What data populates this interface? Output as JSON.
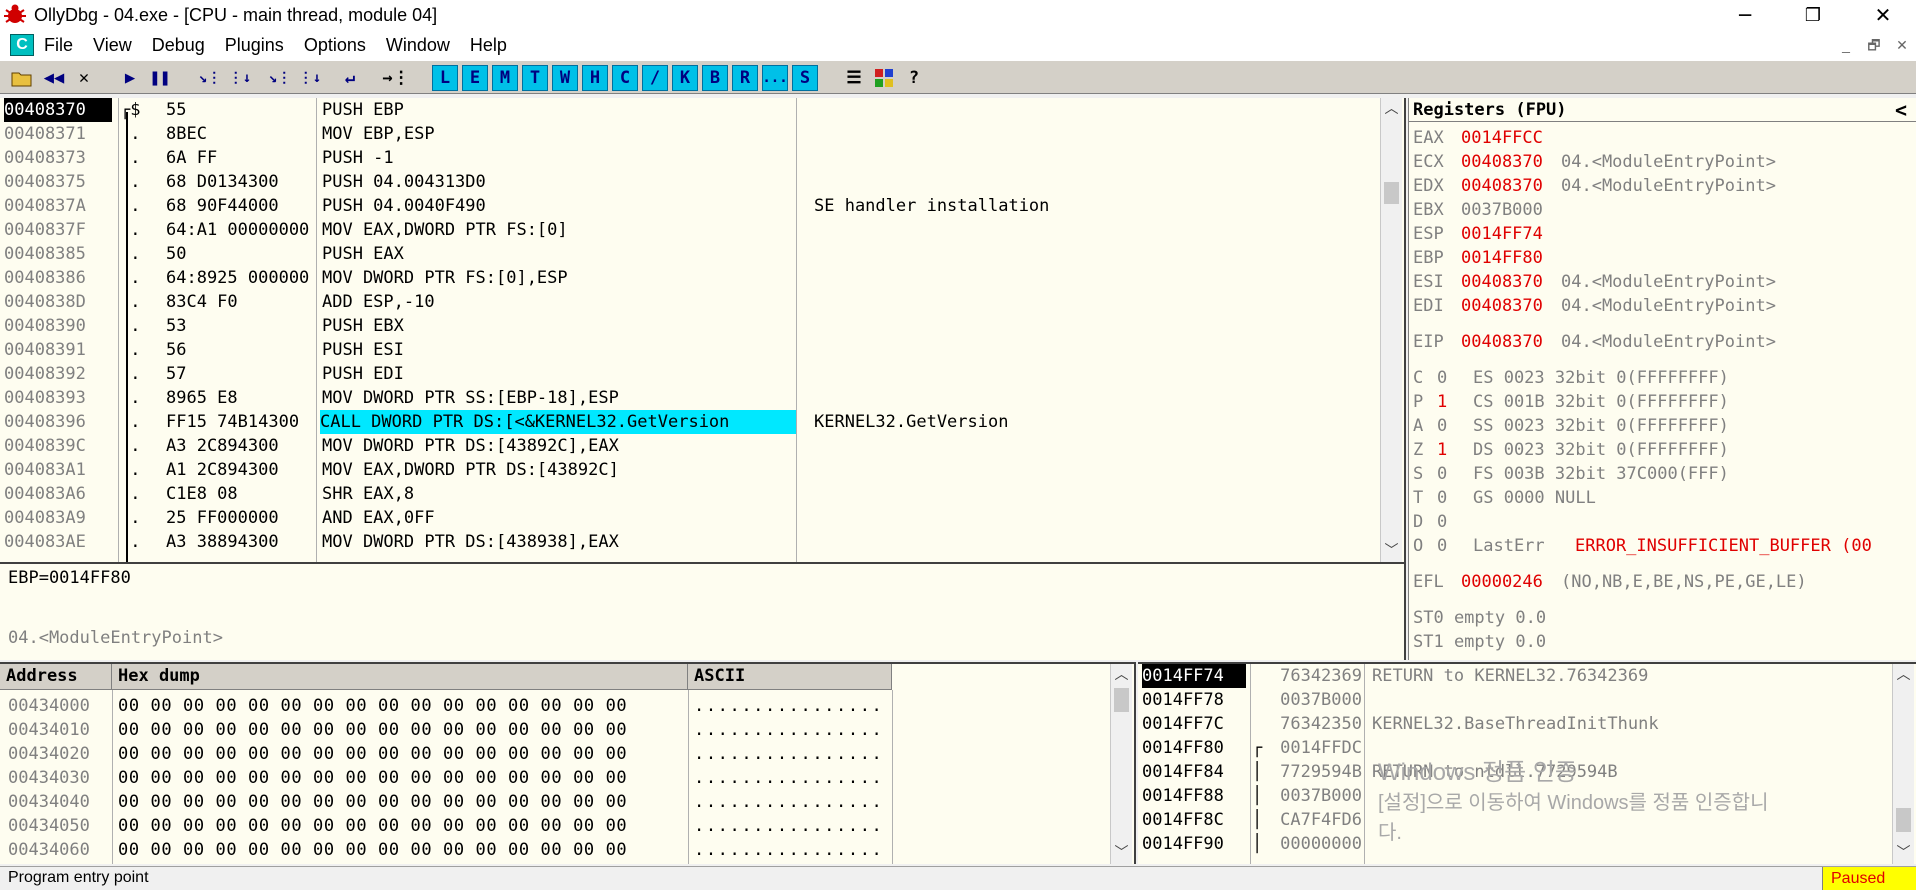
{
  "window": {
    "title": "OllyDbg - 04.exe - [CPU - main thread, module 04]",
    "minimize": "─",
    "restore": "❐",
    "close": "✕"
  },
  "menu": {
    "c_label": "C",
    "items": [
      "File",
      "View",
      "Debug",
      "Plugins",
      "Options",
      "Window",
      "Help"
    ],
    "mdi": [
      "_",
      "🗗",
      "✕"
    ]
  },
  "toolbar": {
    "letters": [
      "L",
      "E",
      "M",
      "T",
      "W",
      "H",
      "C",
      "/",
      "K",
      "B",
      "R",
      "...",
      "S"
    ],
    "help": "?"
  },
  "disasm": {
    "rows": [
      {
        "addr": "00408370",
        "mark": "┌$",
        "hex": "55",
        "cmd": "PUSH EBP",
        "comment": "",
        "selected": true
      },
      {
        "addr": "00408371",
        "mark": " .",
        "hex": "8BEC",
        "cmd": "MOV EBP,ESP",
        "comment": ""
      },
      {
        "addr": "00408373",
        "mark": " .",
        "hex": "6A FF",
        "cmd": "PUSH -1",
        "comment": ""
      },
      {
        "addr": "00408375",
        "mark": " .",
        "hex": "68 D0134300",
        "cmd": "PUSH 04.004313D0",
        "comment": ""
      },
      {
        "addr": "0040837A",
        "mark": " .",
        "hex": "68 90F44000",
        "cmd": "PUSH 04.0040F490",
        "comment": "SE handler installation"
      },
      {
        "addr": "0040837F",
        "mark": " .",
        "hex": "64:A1 00000000",
        "cmd": "MOV EAX,DWORD PTR FS:[0]",
        "comment": ""
      },
      {
        "addr": "00408385",
        "mark": " .",
        "hex": "50",
        "cmd": "PUSH EAX",
        "comment": ""
      },
      {
        "addr": "00408386",
        "mark": " .",
        "hex": "64:8925 000000",
        "cmd": "MOV DWORD PTR FS:[0],ESP",
        "comment": ""
      },
      {
        "addr": "0040838D",
        "mark": " .",
        "hex": "83C4 F0",
        "cmd": "ADD ESP,-10",
        "comment": ""
      },
      {
        "addr": "00408390",
        "mark": " .",
        "hex": "53",
        "cmd": "PUSH EBX",
        "comment": ""
      },
      {
        "addr": "00408391",
        "mark": " .",
        "hex": "56",
        "cmd": "PUSH ESI",
        "comment": ""
      },
      {
        "addr": "00408392",
        "mark": " .",
        "hex": "57",
        "cmd": "PUSH EDI",
        "comment": ""
      },
      {
        "addr": "00408393",
        "mark": " .",
        "hex": "8965 E8",
        "cmd": "MOV DWORD PTR SS:[EBP-18],ESP",
        "comment": ""
      },
      {
        "addr": "00408396",
        "mark": " .",
        "hex": "FF15 74B14300",
        "cmd": "CALL DWORD PTR DS:[<&KERNEL32.GetVersion",
        "comment": "KERNEL32.GetVersion",
        "highlight": true
      },
      {
        "addr": "0040839C",
        "mark": " .",
        "hex": "A3 2C894300",
        "cmd": "MOV DWORD PTR DS:[43892C],EAX",
        "comment": ""
      },
      {
        "addr": "004083A1",
        "mark": " .",
        "hex": "A1 2C894300",
        "cmd": "MOV EAX,DWORD PTR DS:[43892C]",
        "comment": ""
      },
      {
        "addr": "004083A6",
        "mark": " .",
        "hex": "C1E8 08",
        "cmd": "SHR EAX,8",
        "comment": ""
      },
      {
        "addr": "004083A9",
        "mark": " .",
        "hex": "25 FF000000",
        "cmd": "AND EAX,0FF",
        "comment": ""
      },
      {
        "addr": "004083AE",
        "mark": " .",
        "hex": "A3 38894300",
        "cmd": "MOV DWORD PTR DS:[438938],EAX",
        "comment": ""
      }
    ]
  },
  "info": {
    "line1": "EBP=0014FF80",
    "line2": "04.<ModuleEntryPoint>"
  },
  "registers": {
    "header": "Registers (FPU)",
    "collapse": "<",
    "gp": [
      {
        "name": "EAX",
        "value": "0014FFCC",
        "info": ""
      },
      {
        "name": "ECX",
        "value": "00408370",
        "info": "04.<ModuleEntryPoint>"
      },
      {
        "name": "EDX",
        "value": "00408370",
        "info": "04.<ModuleEntryPoint>"
      },
      {
        "name": "EBX",
        "value": "0037B000",
        "info": "",
        "unchanged": true
      },
      {
        "name": "ESP",
        "value": "0014FF74",
        "info": ""
      },
      {
        "name": "EBP",
        "value": "0014FF80",
        "info": ""
      },
      {
        "name": "ESI",
        "value": "00408370",
        "info": "04.<ModuleEntryPoint>"
      },
      {
        "name": "EDI",
        "value": "00408370",
        "info": "04.<ModuleEntryPoint>"
      }
    ],
    "eip": {
      "name": "EIP",
      "value": "00408370",
      "info": "04.<ModuleEntryPoint>"
    },
    "flags": [
      {
        "flag": "C",
        "val": "0",
        "seg": "ES 0023 32bit 0(FFFFFFFF)"
      },
      {
        "flag": "P",
        "val": "1",
        "seg": "CS 001B 32bit 0(FFFFFFFF)",
        "changed": true
      },
      {
        "flag": "A",
        "val": "0",
        "seg": "SS 0023 32bit 0(FFFFFFFF)"
      },
      {
        "flag": "Z",
        "val": "1",
        "seg": "DS 0023 32bit 0(FFFFFFFF)",
        "changed": true
      },
      {
        "flag": "S",
        "val": "0",
        "seg": "FS 003B 32bit 37C000(FFF)"
      },
      {
        "flag": "T",
        "val": "0",
        "seg": "GS 0000 NULL"
      },
      {
        "flag": "D",
        "val": "0",
        "seg": ""
      }
    ],
    "lasterr": {
      "flag": "O",
      "val": "0",
      "label": "LastErr",
      "value": "ERROR_INSUFFICIENT_BUFFER (00"
    },
    "efl": {
      "name": "EFL",
      "value": "00000246",
      "info": "(NO,NB,E,BE,NS,PE,GE,LE)"
    },
    "fpu": [
      "ST0 empty 0.0",
      "ST1 empty 0.0"
    ]
  },
  "dump": {
    "headers": {
      "address": "Address",
      "hex": "Hex dump",
      "ascii": "ASCII"
    },
    "rows": [
      {
        "addr": "00434000",
        "hex": "00 00 00 00 00 00 00 00 00 00 00 00 00 00 00 00",
        "ascii": "................"
      },
      {
        "addr": "00434010",
        "hex": "00 00 00 00 00 00 00 00 00 00 00 00 00 00 00 00",
        "ascii": "................"
      },
      {
        "addr": "00434020",
        "hex": "00 00 00 00 00 00 00 00 00 00 00 00 00 00 00 00",
        "ascii": "................"
      },
      {
        "addr": "00434030",
        "hex": "00 00 00 00 00 00 00 00 00 00 00 00 00 00 00 00",
        "ascii": "................"
      },
      {
        "addr": "00434040",
        "hex": "00 00 00 00 00 00 00 00 00 00 00 00 00 00 00 00",
        "ascii": "................"
      },
      {
        "addr": "00434050",
        "hex": "00 00 00 00 00 00 00 00 00 00 00 00 00 00 00 00",
        "ascii": "................"
      },
      {
        "addr": "00434060",
        "hex": "00 00 00 00 00 00 00 00 00 00 00 00 00 00 00 00",
        "ascii": "................"
      }
    ]
  },
  "stack": {
    "rows": [
      {
        "addr": "0014FF74",
        "mark": " ",
        "value": "76342369",
        "comment": "RETURN to KERNEL32.76342369",
        "selected": true
      },
      {
        "addr": "0014FF78",
        "mark": " ",
        "value": "0037B000",
        "comment": ""
      },
      {
        "addr": "0014FF7C",
        "mark": " ",
        "value": "76342350",
        "comment": "KERNEL32.BaseThreadInitThunk"
      },
      {
        "addr": "0014FF80",
        "mark": "┌",
        "value": "0014FFDC",
        "comment": ""
      },
      {
        "addr": "0014FF84",
        "mark": "│",
        "value": "7729594B",
        "comment": "RETURN to ntdll.7729594B"
      },
      {
        "addr": "0014FF88",
        "mark": "│",
        "value": "0037B000",
        "comment": ""
      },
      {
        "addr": "0014FF8C",
        "mark": "│",
        "value": "CA7F4FD6",
        "comment": ""
      },
      {
        "addr": "0014FF90",
        "mark": "│",
        "value": "00000000",
        "comment": ""
      }
    ]
  },
  "watermark": {
    "line1": "Windows 정품 인증",
    "line2": "[설정]으로 이동하여 Windows를 정품 인증합니",
    "line3": "다."
  },
  "status": {
    "text": "Program entry point",
    "state": "Paused"
  }
}
